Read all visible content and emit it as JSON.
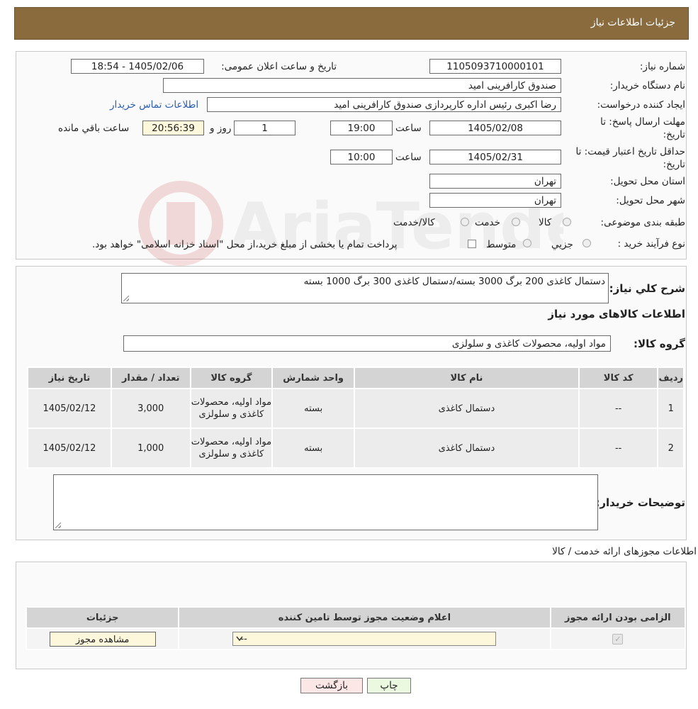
{
  "header": {
    "title": "جزئیات اطلاعات نیاز"
  },
  "details": {
    "need_number_label": "شماره نیاز:",
    "need_number": "1105093710000101",
    "announce_label": "تاریخ و ساعت اعلان عمومی:",
    "announce_value": "1405/02/06 - 18:54",
    "buyer_org_label": "نام دستگاه خریدار:",
    "buyer_org": "صندوق کارافرینی امید",
    "requester_label": "ایجاد کننده درخواست:",
    "requester": "رضا اکبری رئیس اداره کارپردازی صندوق کارافرینی امید",
    "contact_link": "اطلاعات تماس خریدار",
    "reply_deadline_label": "مهلت ارسال پاسخ: تا تاریخ:",
    "reply_date": "1405/02/08",
    "time_label": "ساعت",
    "reply_time": "19:00",
    "days_value": "1",
    "days_label": "روز و",
    "remaining_time": "20:56:39",
    "remaining_label": "ساعت باقي مانده",
    "price_validity_label": "حداقل تاريخ اعتبار قيمت: تا تاریخ:",
    "price_date": "1405/02/31",
    "price_time": "10:00",
    "province_label": "استان محل تحویل:",
    "province": "تهران",
    "city_label": "شهر محل تحویل:",
    "city": "تهران",
    "category_label": "طبقه بندی موضوعی:",
    "category_options": [
      "کالا",
      "خدمت",
      "کالا/خدمت"
    ],
    "process_label": "نوع فرآیند خرید :",
    "process_options": [
      "جزیي",
      "متوسط"
    ],
    "process_note": "پرداخت تمام یا بخشی از مبلغ خرید،از محل \"اسناد خزانه اسلامی\" خواهد بود."
  },
  "needs": {
    "description_label": "شرح کلي نياز:",
    "description": "دستمال کاغذی 200 برگ 3000 بسته/دستمال کاغذی 300 برگ 1000 بسته",
    "goods_info_title": "اطلاعات کالاهای مورد نیاز",
    "goods_group_label": "گروه کالا:",
    "goods_group": "مواد اولیه، محصولات کاغذی و سلولزی",
    "table": {
      "headers": [
        "رديف",
        "کد کالا",
        "نام کالا",
        "واحد شمارش",
        "گروه کالا",
        "تعداد / مقدار",
        "تاریخ نیاز"
      ],
      "rows": [
        [
          "1",
          "--",
          "دستمال کاغذی",
          "بسته",
          "مواد اولیه، محصولات کاغذی و سلولزی",
          "3,000",
          "1405/02/12"
        ],
        [
          "2",
          "--",
          "دستمال کاغذی",
          "بسته",
          "مواد اولیه، محصولات کاغذی و سلولزی",
          "1,000",
          "1405/02/12"
        ]
      ]
    },
    "buyer_notes_label": "توضیحات خریدار:"
  },
  "permits": {
    "title": "اطلاعات مجوزهای ارائه خدمت / کالا",
    "headers": [
      "الزامی بودن ارائه مجوز",
      "اعلام وضعیت مجوز توسط تامین کننده",
      "جزئیات"
    ],
    "select_value": "--",
    "view_button": "مشاهده مجوز"
  },
  "actions": {
    "print": "چاپ",
    "back": "بازگشت"
  },
  "colors": {
    "header_bg": "#8a6b3e",
    "link": "#2a5db0",
    "back_btn_bg": "#fde6e6",
    "print_btn_bg": "#eaf9df"
  }
}
